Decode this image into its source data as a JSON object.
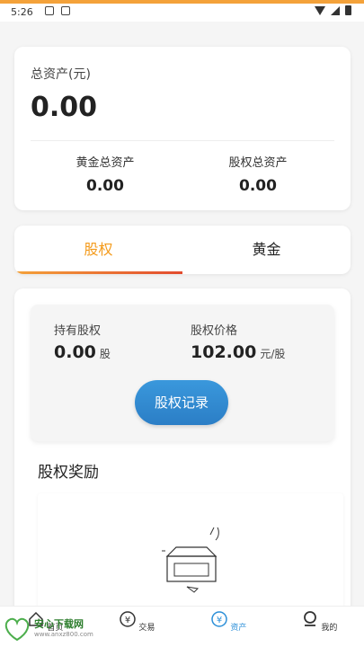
{
  "status_bar": {
    "time": "5:26"
  },
  "total_assets": {
    "label": "总资产(元)",
    "value": "0.00",
    "gold_label": "黄金总资产",
    "gold_value": "0.00",
    "equity_label": "股权总资产",
    "equity_value": "0.00"
  },
  "tabs": [
    {
      "label": "股权",
      "active": true
    },
    {
      "label": "黄金",
      "active": false
    }
  ],
  "equity": {
    "holding_label": "持有股权",
    "holding_value": "0.00",
    "holding_unit": "股",
    "price_label": "股权价格",
    "price_value": "102.00",
    "price_unit": "元/股",
    "record_button": "股权记录",
    "reward_title": "股权奖励"
  },
  "bottom_nav": [
    {
      "label": "首页",
      "icon": "home-icon"
    },
    {
      "label": "交易",
      "icon": "yen-circle-icon"
    },
    {
      "label": "资产",
      "icon": "yen-circle-icon",
      "active": true
    },
    {
      "label": "我的",
      "icon": "user-icon"
    }
  ],
  "watermark": {
    "title": "安心下载网",
    "url": "www.anxz800.com",
    "logo_text": "安心 下载"
  },
  "colors": {
    "accent_orange": "#f49a1a",
    "accent_blue": "#2b8fd8",
    "tab_gradient_end": "#e24b2e"
  }
}
